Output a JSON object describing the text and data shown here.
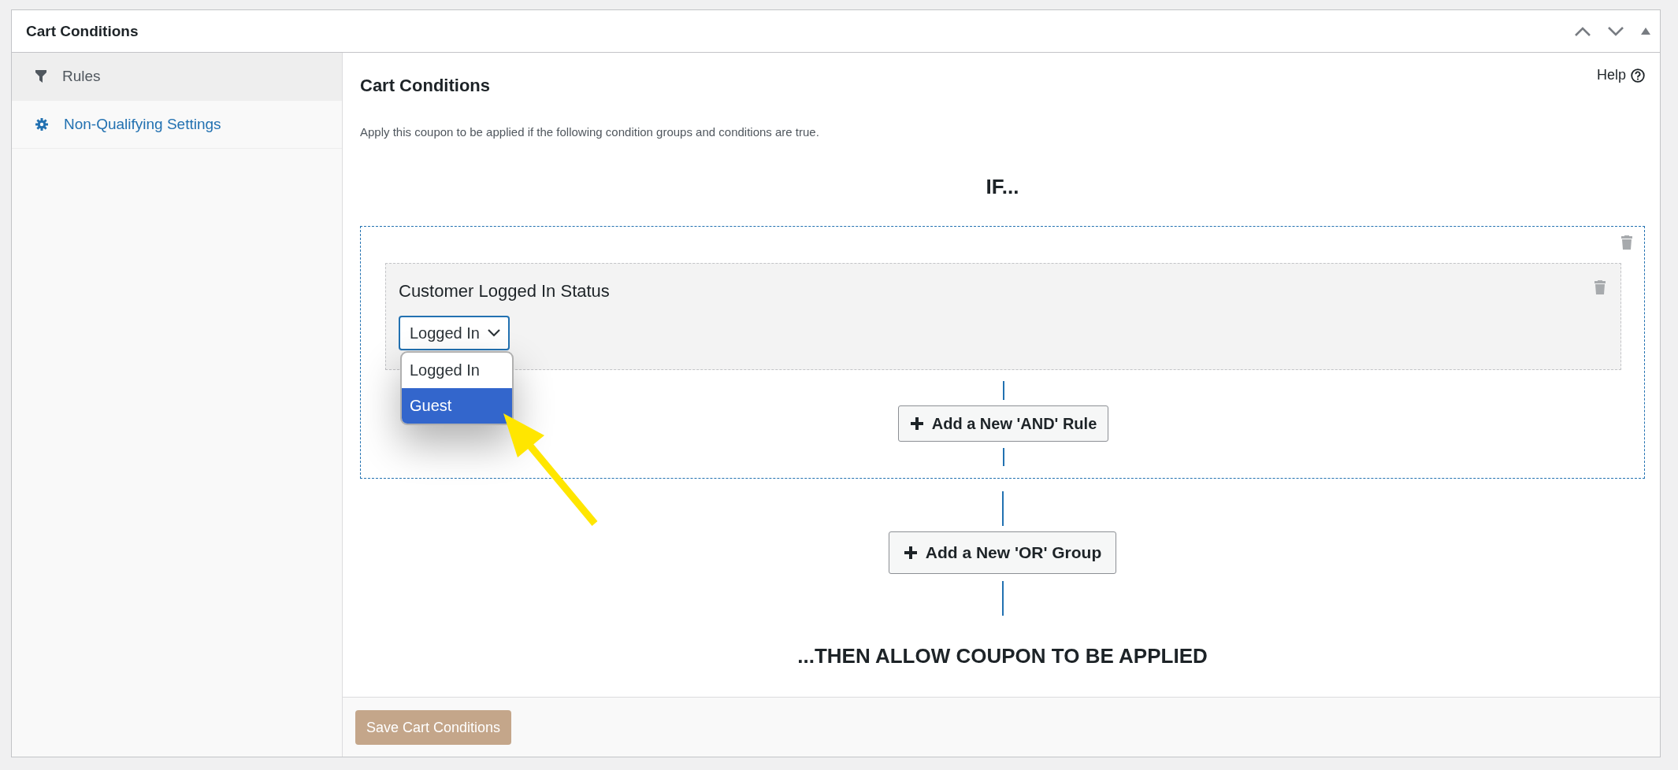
{
  "panel": {
    "title": "Cart Conditions"
  },
  "sidebar": {
    "items": [
      {
        "label": "Rules",
        "selected": true
      },
      {
        "label": "Non-Qualifying Settings",
        "selected": false
      }
    ]
  },
  "main": {
    "title": "Cart Conditions",
    "help_label": "Help",
    "description": "Apply this coupon to be applied if the following condition groups and conditions are true.",
    "if_label": "IF...",
    "groups": [
      {
        "rules": [
          {
            "title": "Customer Logged In Status",
            "select": {
              "value": "Logged In",
              "expanded": true,
              "options": [
                {
                  "label": "Logged In",
                  "highlighted": false
                },
                {
                  "label": "Guest",
                  "highlighted": true
                }
              ]
            }
          }
        ],
        "add_rule_button": "Add a New 'AND' Rule"
      }
    ],
    "add_group_button": "Add a New 'OR' Group",
    "then_label": "...THEN ALLOW COUPON TO BE APPLIED",
    "save_button": "Save Cart Conditions"
  }
}
